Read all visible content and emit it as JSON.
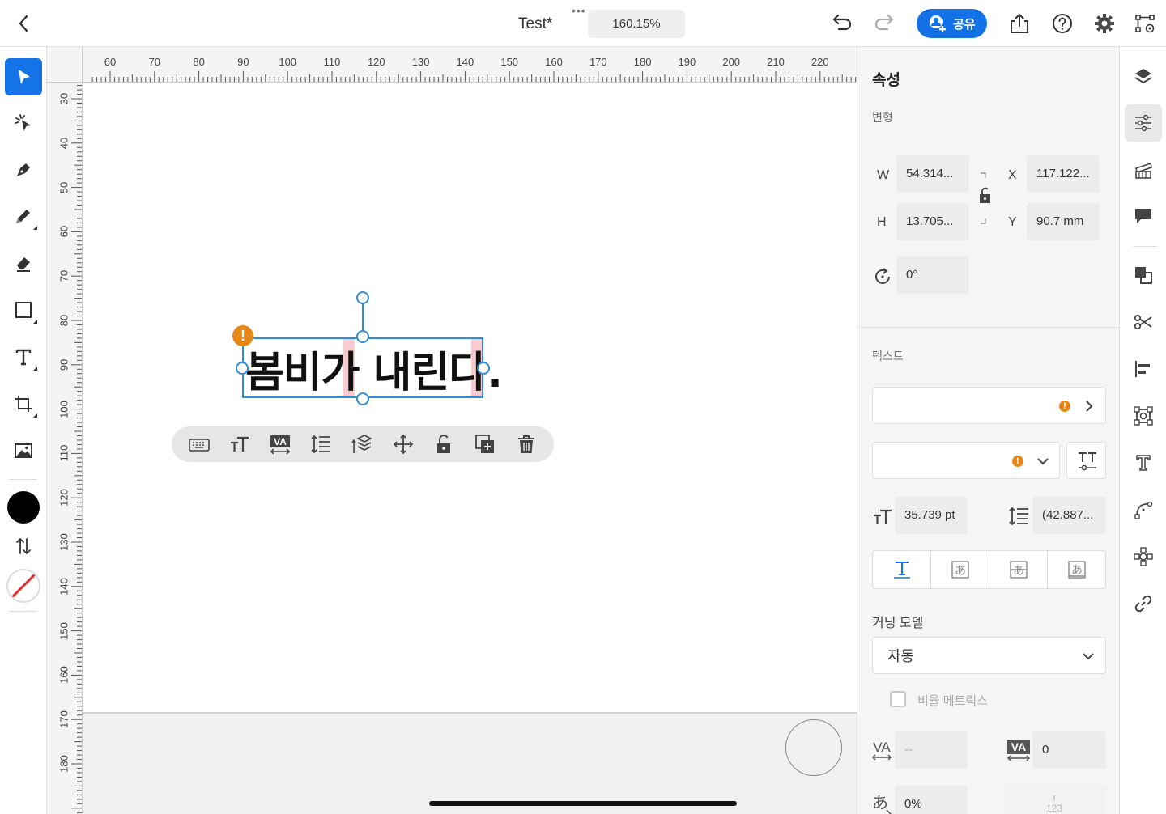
{
  "topbar": {
    "title": "Test*",
    "zoom": "160.15%",
    "more": "•••",
    "share_label": "공유"
  },
  "rulers": {
    "top": [
      "60",
      "70",
      "80",
      "90",
      "100",
      "110",
      "120",
      "130",
      "140",
      "150",
      "160",
      "170",
      "180",
      "190",
      "200",
      "210",
      "220"
    ],
    "left": [
      "30",
      "40",
      "50",
      "60",
      "70",
      "80",
      "90",
      "100",
      "110",
      "120",
      "130",
      "140",
      "150",
      "160",
      "170",
      "180"
    ]
  },
  "canvas": {
    "text": "봄비가 내린다."
  },
  "panel": {
    "title": "속성",
    "transform_heading": "변형",
    "w_label": "W",
    "w_value": "54.314...",
    "h_label": "H",
    "h_value": "13.705...",
    "x_label": "X",
    "x_value": "117.122...",
    "y_label": "Y",
    "y_value": "90.7 mm",
    "rotation_value": "0°",
    "text_heading": "텍스트",
    "font_size": "35.739 pt",
    "leading": "(42.887...",
    "kerning_label": "커닝 모델",
    "kerning_value": "자동",
    "proportional_metrics": "비율 메트릭스",
    "kerning_amount": "--",
    "tracking_value": "0",
    "tsume_value": "0%"
  }
}
